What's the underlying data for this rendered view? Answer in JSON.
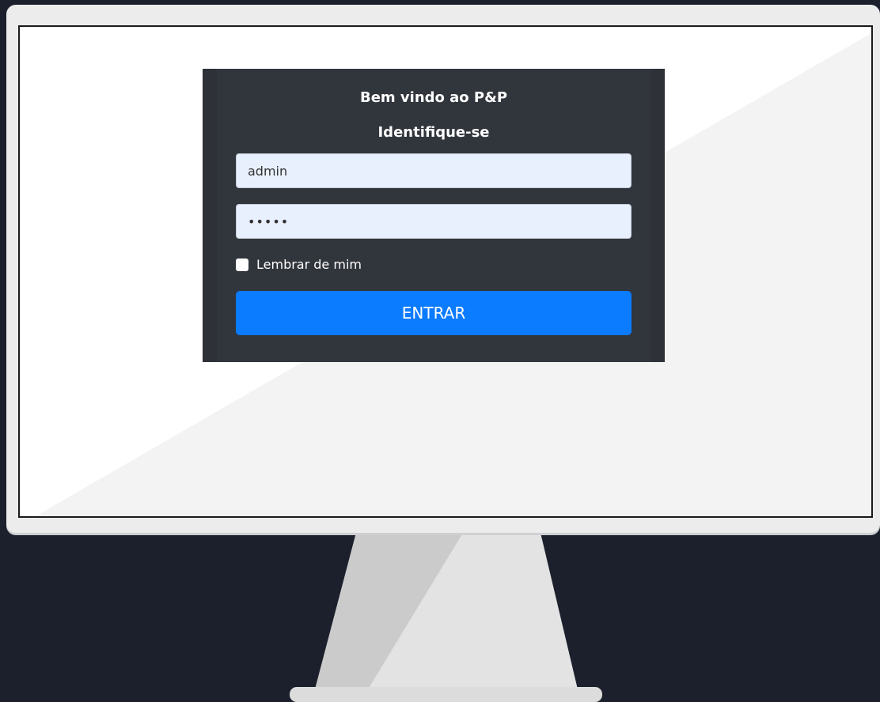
{
  "login": {
    "title": "Bem vindo ao P&P",
    "subtitle": "Identifique-se",
    "username_value": "admin",
    "password_value": "•••••",
    "remember_label": "Lembrar de mim",
    "submit_label": "ENTRAR"
  },
  "colors": {
    "background": "#1b202c",
    "card": "#2a2e36",
    "button": "#0b7bff",
    "input": "#e8f0fe"
  }
}
